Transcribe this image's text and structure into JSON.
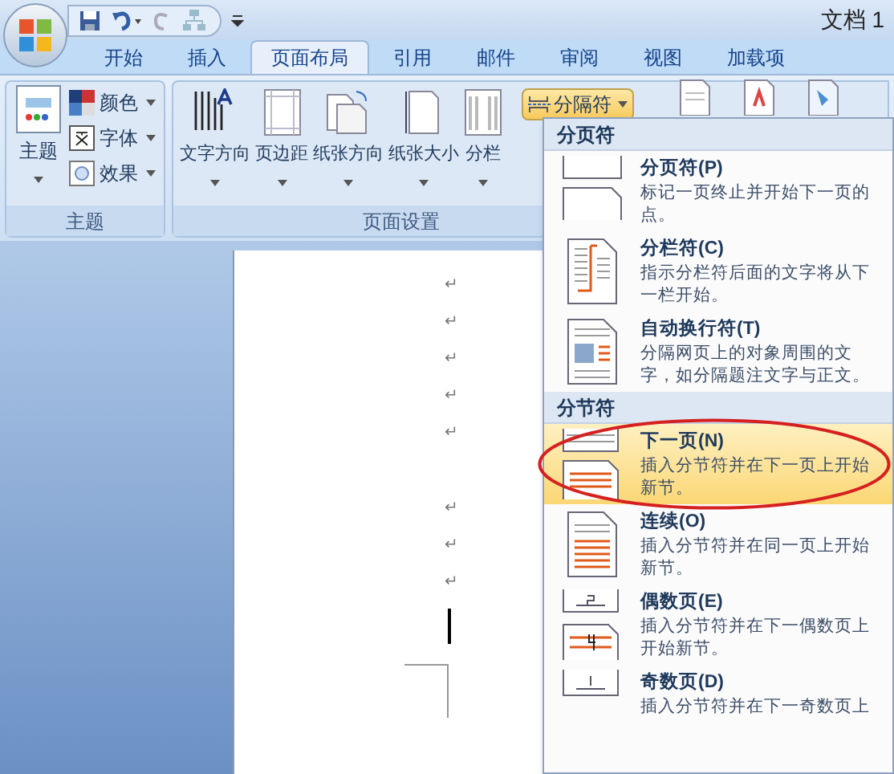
{
  "title_bar": {
    "title": "文档 1"
  },
  "tabs": [
    {
      "label": "开始",
      "selected": false
    },
    {
      "label": "插入",
      "selected": false
    },
    {
      "label": "页面布局",
      "selected": true
    },
    {
      "label": "引用",
      "selected": false
    },
    {
      "label": "邮件",
      "selected": false
    },
    {
      "label": "审阅",
      "selected": false
    },
    {
      "label": "视图",
      "selected": false
    },
    {
      "label": "加载项",
      "selected": false
    }
  ],
  "theme_group": {
    "label": "主题",
    "big_button": {
      "label": "主题"
    },
    "small_buttons": [
      {
        "label": "颜色",
        "kind": "colors"
      },
      {
        "label": "字体",
        "kind": "fonts"
      },
      {
        "label": "效果",
        "kind": "effects"
      }
    ]
  },
  "page_setup_group": {
    "label": "页面设置",
    "buttons": [
      {
        "label": "文字方向",
        "kind": "text-direction",
        "has_menu": true
      },
      {
        "label": "页边距",
        "kind": "margins",
        "has_menu": true
      },
      {
        "label": "纸张方向",
        "kind": "orientation",
        "has_menu": true
      },
      {
        "label": "纸张大小",
        "kind": "size",
        "has_menu": true
      },
      {
        "label": "分栏",
        "kind": "columns",
        "has_menu": true
      }
    ],
    "breaks_button": {
      "label": "分隔符",
      "pressed": true
    }
  },
  "document": {
    "paragraph_marks": [
      "↵",
      "↵",
      "↵",
      "↵",
      "↵",
      "↵",
      "↵",
      "↵"
    ]
  },
  "breaks_menu": {
    "sections": [
      {
        "heading": "分页符",
        "items": [
          {
            "kind": "page",
            "title": "分页符(P)",
            "description": "标记一页终止并开始下一页的点。",
            "selected": false
          },
          {
            "kind": "column",
            "title": "分栏符(C)",
            "description": "指示分栏符后面的文字将从下一栏开始。",
            "selected": false
          },
          {
            "kind": "wrap",
            "title": "自动换行符(T)",
            "description": "分隔网页上的对象周围的文字，如分隔题注文字与正文。",
            "selected": false
          }
        ]
      },
      {
        "heading": "分节符",
        "items": [
          {
            "kind": "next",
            "title": "下一页(N)",
            "description": "插入分节符并在下一页上开始新节。",
            "selected": true
          },
          {
            "kind": "continuous",
            "title": "连续(O)",
            "description": "插入分节符并在同一页上开始新节。",
            "selected": false
          },
          {
            "kind": "even",
            "title": "偶数页(E)",
            "description": "插入分节符并在下一偶数页上开始新节。",
            "selected": false
          },
          {
            "kind": "odd",
            "title": "奇数页(D)",
            "description": "插入分节符并在下一奇数页上",
            "selected": false
          }
        ]
      }
    ]
  }
}
